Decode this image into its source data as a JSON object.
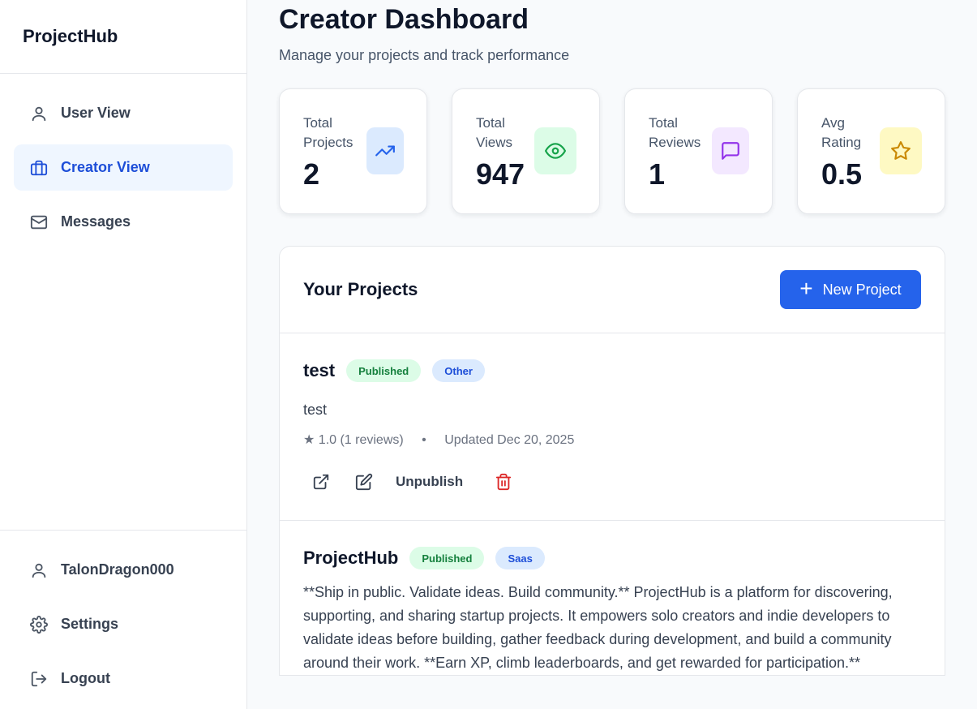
{
  "sidebar": {
    "brand": "ProjectHub",
    "nav": [
      {
        "label": "User View",
        "icon": "user-icon",
        "active": false
      },
      {
        "label": "Creator View",
        "icon": "briefcase-icon",
        "active": true
      },
      {
        "label": "Messages",
        "icon": "mail-icon",
        "active": false
      }
    ],
    "bottom": [
      {
        "label": "TalonDragon000",
        "icon": "user-icon"
      },
      {
        "label": "Settings",
        "icon": "gear-icon"
      },
      {
        "label": "Logout",
        "icon": "logout-icon"
      }
    ]
  },
  "header": {
    "title": "Creator Dashboard",
    "subtitle": "Manage your projects and track performance"
  },
  "stats": [
    {
      "label": "Total Projects",
      "value": "2",
      "icon": "trending-up-icon",
      "color": "#2563eb",
      "bg": "#dbeafe"
    },
    {
      "label": "Total Views",
      "value": "947",
      "icon": "eye-icon",
      "color": "#16a34a",
      "bg": "#dcfce7"
    },
    {
      "label": "Total Reviews",
      "value": "1",
      "icon": "message-icon",
      "color": "#9333ea",
      "bg": "#f3e8ff"
    },
    {
      "label": "Avg Rating",
      "value": "0.5",
      "icon": "star-icon",
      "color": "#ca8a04",
      "bg": "#fef9c3"
    }
  ],
  "projects": {
    "heading": "Your Projects",
    "new_label": "New Project",
    "items": [
      {
        "title": "test",
        "status": "Published",
        "category": "Other",
        "description": "test",
        "rating": "★ 1.0 (1 reviews)",
        "separator": "•",
        "updated": "Updated Dec 20, 2025",
        "unpublish_label": "Unpublish"
      },
      {
        "title": "ProjectHub",
        "status": "Published",
        "category": "Saas",
        "description": "**Ship in public. Validate ideas. Build community.** ProjectHub is a platform for discovering, supporting, and sharing startup projects. It empowers solo creators and indie developers to validate ideas before building, gather feedback during development, and build a community around their work. **Earn XP, climb leaderboards, and get rewarded for participation.**"
      }
    ]
  },
  "colors": {
    "accent": "#2563eb",
    "danger": "#dc2626"
  }
}
